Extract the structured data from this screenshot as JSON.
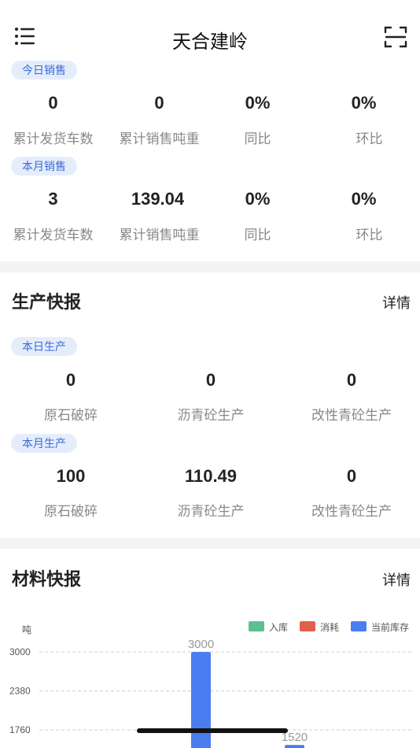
{
  "header": {
    "title": "天合建岭",
    "menu_icon": "list-menu-icon",
    "scan_icon": "scan-icon"
  },
  "sales": {
    "today": {
      "tag": "今日销售",
      "stats": [
        {
          "value": "0",
          "label": "累计发货车数"
        },
        {
          "value": "0",
          "label": "累计销售吨重"
        },
        {
          "value": "0%",
          "label": "同比"
        },
        {
          "value": "0%",
          "label": "环比"
        }
      ]
    },
    "month": {
      "tag": "本月销售",
      "stats": [
        {
          "value": "3",
          "label": "累计发货车数"
        },
        {
          "value": "139.04",
          "label": "累计销售吨重"
        },
        {
          "value": "0%",
          "label": "同比"
        },
        {
          "value": "0%",
          "label": "环比"
        }
      ]
    }
  },
  "production": {
    "title": "生产快报",
    "detail_label": "详情",
    "today": {
      "tag": "本日生产",
      "stats": [
        {
          "value": "0",
          "label": "原石破碎"
        },
        {
          "value": "0",
          "label": "沥青砼生产"
        },
        {
          "value": "0",
          "label": "改性青砼生产"
        }
      ]
    },
    "month": {
      "tag": "本月生产",
      "stats": [
        {
          "value": "100",
          "label": "原石破碎"
        },
        {
          "value": "110.49",
          "label": "沥青砼生产"
        },
        {
          "value": "0",
          "label": "改性青砼生产"
        }
      ]
    }
  },
  "materials": {
    "title": "材料快报",
    "detail_label": "详情"
  },
  "chart_data": {
    "type": "bar",
    "ylabel": "吨",
    "yticks": [
      3000,
      2380,
      1760
    ],
    "series": [
      {
        "name": "入库",
        "color": "#5bbf94",
        "values": [
          0,
          0
        ]
      },
      {
        "name": "消耗",
        "color": "#e0604d",
        "values": [
          0,
          0
        ]
      },
      {
        "name": "当前库存",
        "color": "#4a7ef0",
        "values": [
          3000,
          1520
        ]
      }
    ],
    "data_labels": [
      "3000",
      "1520"
    ],
    "grid": true,
    "legend": "top-right"
  }
}
